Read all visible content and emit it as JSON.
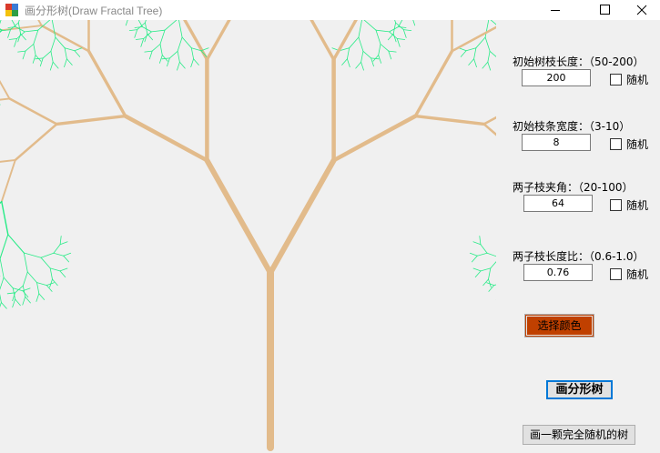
{
  "window": {
    "title": "画分形树(Draw Fractal Tree)"
  },
  "fields": [
    {
      "label": "初始树枝长度：（50-200）",
      "value": "200",
      "random_label": "随机",
      "random_checked": false
    },
    {
      "label": "初始枝条宽度：（3-10）",
      "value": "8",
      "random_label": "随机",
      "random_checked": false
    },
    {
      "label": "两子枝夹角：（20-100）",
      "value": "64",
      "random_label": "随机",
      "random_checked": false
    },
    {
      "label": "两子枝长度比：（0.6-1.0）",
      "value": "0.76",
      "random_label": "随机",
      "random_checked": false
    }
  ],
  "buttons": {
    "choose_color": "选择颜色",
    "draw_tree": "画分形树",
    "draw_random_tree": "画一颗完全随机的树"
  },
  "colors": {
    "trunk": "#e2bb8b",
    "leaf": "#28eb87",
    "selected_color": "#c04000",
    "background": "#f0f0f0"
  },
  "icons": {
    "app": "app-icon",
    "minimize": "minimize-icon",
    "maximize": "maximize-icon",
    "close": "close-icon",
    "checkbox": "checkbox-icon"
  }
}
